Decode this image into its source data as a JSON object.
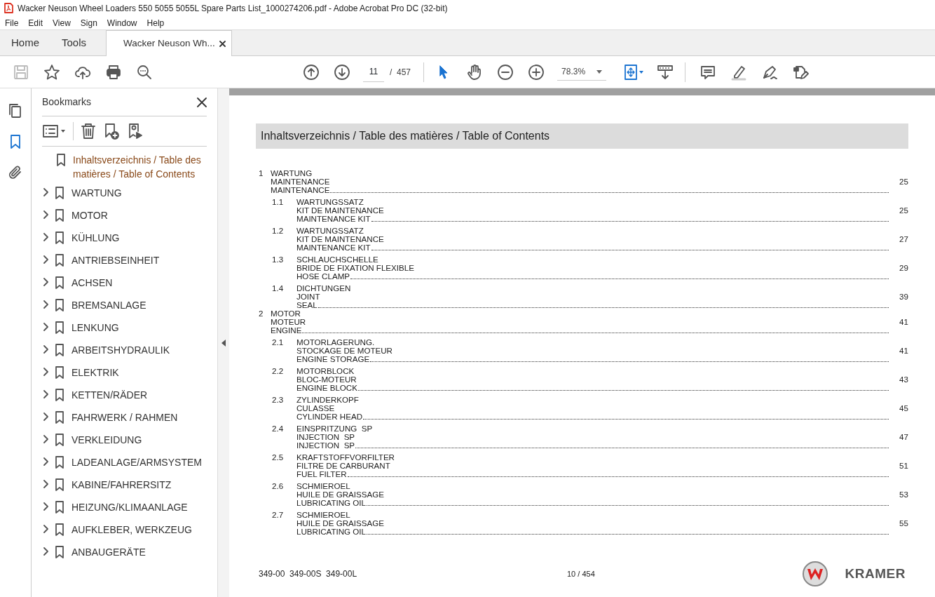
{
  "window": {
    "title": "Wacker Neuson Wheel Loaders 550 5055 5055L Spare Parts List_1000274206.pdf - Adobe Acrobat Pro DC (32-bit)"
  },
  "menu": [
    "File",
    "Edit",
    "View",
    "Sign",
    "Window",
    "Help"
  ],
  "tabs": [
    {
      "label": "Home",
      "selected": false,
      "kind": "nav"
    },
    {
      "label": "Tools",
      "selected": false,
      "kind": "nav"
    },
    {
      "label": "Wacker Neuson Wh...",
      "selected": true,
      "kind": "document"
    }
  ],
  "toolbar": {
    "page_field": "11",
    "page_total": "/  457",
    "zoom": "78.3%"
  },
  "side_rail": [
    {
      "selected": false
    },
    {
      "selected": true
    },
    {
      "selected": false
    }
  ],
  "bookmarks": {
    "title": "Bookmarks",
    "items": [
      {
        "label": "Inhaltsverzeichnis / Table des matières / Table of Contents",
        "kind": "leaf"
      },
      {
        "label": "WARTUNG",
        "kind": "group",
        "expanded": false
      },
      {
        "label": "MOTOR",
        "kind": "group",
        "expanded": false
      },
      {
        "label": "KÜHLUNG",
        "kind": "group",
        "expanded": false
      },
      {
        "label": "ANTRIEBSEINHEIT",
        "kind": "group",
        "expanded": false
      },
      {
        "label": "ACHSEN",
        "kind": "group",
        "expanded": false
      },
      {
        "label": "BREMSANLAGE",
        "kind": "group",
        "expanded": false
      },
      {
        "label": "LENKUNG",
        "kind": "group",
        "expanded": false
      },
      {
        "label": "ARBEITSHYDRAULIK",
        "kind": "group",
        "expanded": false
      },
      {
        "label": "ELEKTRIK",
        "kind": "group",
        "expanded": false
      },
      {
        "label": "KETTEN/RÄDER",
        "kind": "group",
        "expanded": false
      },
      {
        "label": "FAHRWERK / RAHMEN",
        "kind": "group",
        "expanded": false
      },
      {
        "label": "VERKLEIDUNG",
        "kind": "group",
        "expanded": false
      },
      {
        "label": "LADEANLAGE/ARMSYSTEM",
        "kind": "group",
        "expanded": false
      },
      {
        "label": "KABINE/FAHRERSITZ",
        "kind": "group",
        "expanded": false
      },
      {
        "label": "HEIZUNG/KLIMAANLAGE",
        "kind": "group",
        "expanded": false
      },
      {
        "label": "AUFKLEBER, WERKZEUG",
        "kind": "group",
        "expanded": false
      },
      {
        "label": "ANBAUGERÄTE",
        "kind": "group",
        "expanded": false
      }
    ]
  },
  "document": {
    "heading": "Inhaltsverzeichnis / Table des matières / Table of Contents",
    "toc": [
      {
        "number": "1",
        "lines": [
          "WARTUNG",
          "MAINTENANCE",
          "MAINTENANCE"
        ],
        "page": "25",
        "children": [
          {
            "number": "1.1",
            "lines": [
              "WARTUNGSSATZ",
              "KIT DE MAINTENANCE",
              "MAINTENANCE KIT"
            ],
            "page": "25"
          },
          {
            "number": "1.2",
            "lines": [
              "WARTUNGSSATZ",
              "KIT DE MAINTENANCE",
              "MAINTENANCE KIT"
            ],
            "page": "27"
          },
          {
            "number": "1.3",
            "lines": [
              "SCHLAUCHSCHELLE",
              "BRIDE DE FIXATION FLEXIBLE",
              "HOSE CLAMP"
            ],
            "page": "29"
          },
          {
            "number": "1.4",
            "lines": [
              "DICHTUNGEN",
              "JOINT",
              "SEAL"
            ],
            "page": "39"
          }
        ]
      },
      {
        "number": "2",
        "lines": [
          "MOTOR",
          "MOTEUR",
          "ENGINE"
        ],
        "page": "41",
        "children": [
          {
            "number": "2.1",
            "lines": [
              "MOTORLAGERUNG.",
              "STOCKAGE DE MOTEUR",
              "ENGINE STORAGE"
            ],
            "page": "41"
          },
          {
            "number": "2.2",
            "lines": [
              "MOTORBLOCK",
              "BLOC-MOTEUR",
              "ENGINE BLOCK"
            ],
            "page": "43"
          },
          {
            "number": "2.3",
            "lines": [
              "ZYLINDERKOPF",
              "CULASSE",
              "CYLINDER HEAD"
            ],
            "page": "45"
          },
          {
            "number": "2.4",
            "lines": [
              "EINSPRITZUNG  SP",
              "INJECTION  SP",
              "INJECTION  SP"
            ],
            "page": "47"
          },
          {
            "number": "2.5",
            "lines": [
              "KRAFTSTOFFVORFILTER",
              "FILTRE DE CARBURANT",
              "FUEL FILTER"
            ],
            "page": "51"
          },
          {
            "number": "2.6",
            "lines": [
              "SCHMIEROEL",
              "HUILE DE GRAISSAGE",
              "LUBRICATING OIL"
            ],
            "page": "53"
          },
          {
            "number": "2.7",
            "lines": [
              "SCHMIEROEL",
              "HUILE DE GRAISSAGE",
              "LUBRICATING OIL"
            ],
            "page": "55"
          }
        ]
      }
    ],
    "footer": {
      "models": "349-00  349-00S  349-00L",
      "page_counter": "10 / 454",
      "logo_text": "KRAMER"
    }
  }
}
